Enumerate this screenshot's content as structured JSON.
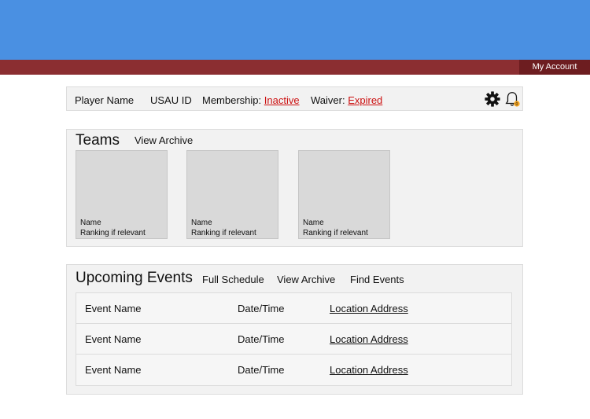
{
  "header": {
    "account_label": "My Account"
  },
  "player": {
    "name_label": "Player Name",
    "usau_label": "USAU ID",
    "membership_label": "Membership:",
    "membership_status": "Inactive",
    "waiver_label": "Waiver:",
    "waiver_status": "Expired",
    "notification_count": "0",
    "icons": [
      "gear-icon",
      "bell-icon"
    ]
  },
  "teams": {
    "title": "Teams",
    "archive_label": "View Archive",
    "cards": [
      {
        "name": "Name",
        "ranking": "Ranking if relevant"
      },
      {
        "name": "Name",
        "ranking": "Ranking if relevant"
      },
      {
        "name": "Name",
        "ranking": "Ranking if relevant"
      }
    ]
  },
  "events": {
    "title": "Upcoming Events",
    "links": [
      "Full Schedule",
      "View Archive",
      "Find Events"
    ],
    "rows": [
      {
        "name": "Event Name",
        "datetime": "Date/Time",
        "location": "Location Address"
      },
      {
        "name": "Event Name",
        "datetime": "Date/Time",
        "location": "Location Address"
      },
      {
        "name": "Event Name",
        "datetime": "Date/Time",
        "location": "Location Address"
      }
    ]
  },
  "colors": {
    "banner": "#4a90e2",
    "navbar": "#8b2e31",
    "status_red": "#cc1111"
  }
}
